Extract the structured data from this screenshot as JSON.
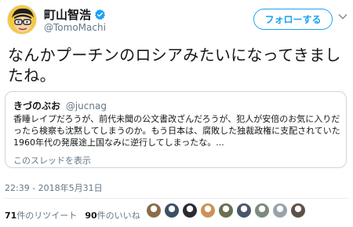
{
  "author": {
    "display_name": "町山智浩",
    "handle": "@TomoMachi",
    "verified": true
  },
  "follow_button": {
    "label": "フォローする"
  },
  "tweet": {
    "text": "なんかプーチンのロシアみたいになってきましたね。",
    "timestamp": "22:39 - 2018年5月31日"
  },
  "quoted_tweet": {
    "display_name": "きづのぶお",
    "handle": "@jucnag",
    "text": "香睡レイプだろうが、前代未聞の公文書改ざんだろうが、犯人が安倍のお気に入りだったら検察も沈黙してしまうのか。もう日本は、腐敗した独裁政権に支配されていた1960年代の発展途上国なみに逆行してしまったな。...",
    "thread_link": "このスレッドを表示"
  },
  "stats": {
    "retweet_count": "71",
    "retweet_label": "件のリツイート",
    "like_count": "90",
    "like_label": "件のいいね"
  },
  "likers": [
    {
      "icon": "liker-avatar",
      "color": "#8a6d4b"
    },
    {
      "icon": "liker-avatar",
      "color": "#3d4f63"
    },
    {
      "icon": "liker-avatar",
      "color": "#2b2b33"
    },
    {
      "icon": "liker-avatar",
      "color": "#c9935a"
    },
    {
      "icon": "liker-avatar",
      "color": "#6b6f52"
    },
    {
      "icon": "liker-avatar",
      "color": "#4a5668"
    },
    {
      "icon": "liker-avatar",
      "color": "#7b8a7e"
    },
    {
      "icon": "liker-avatar",
      "color": "#9aa3ab"
    },
    {
      "icon": "liker-avatar",
      "color": "#5d5148"
    }
  ],
  "colors": {
    "accent": "#1da1f2",
    "text": "#14171a",
    "muted": "#657786",
    "border": "#ccd6dd"
  }
}
